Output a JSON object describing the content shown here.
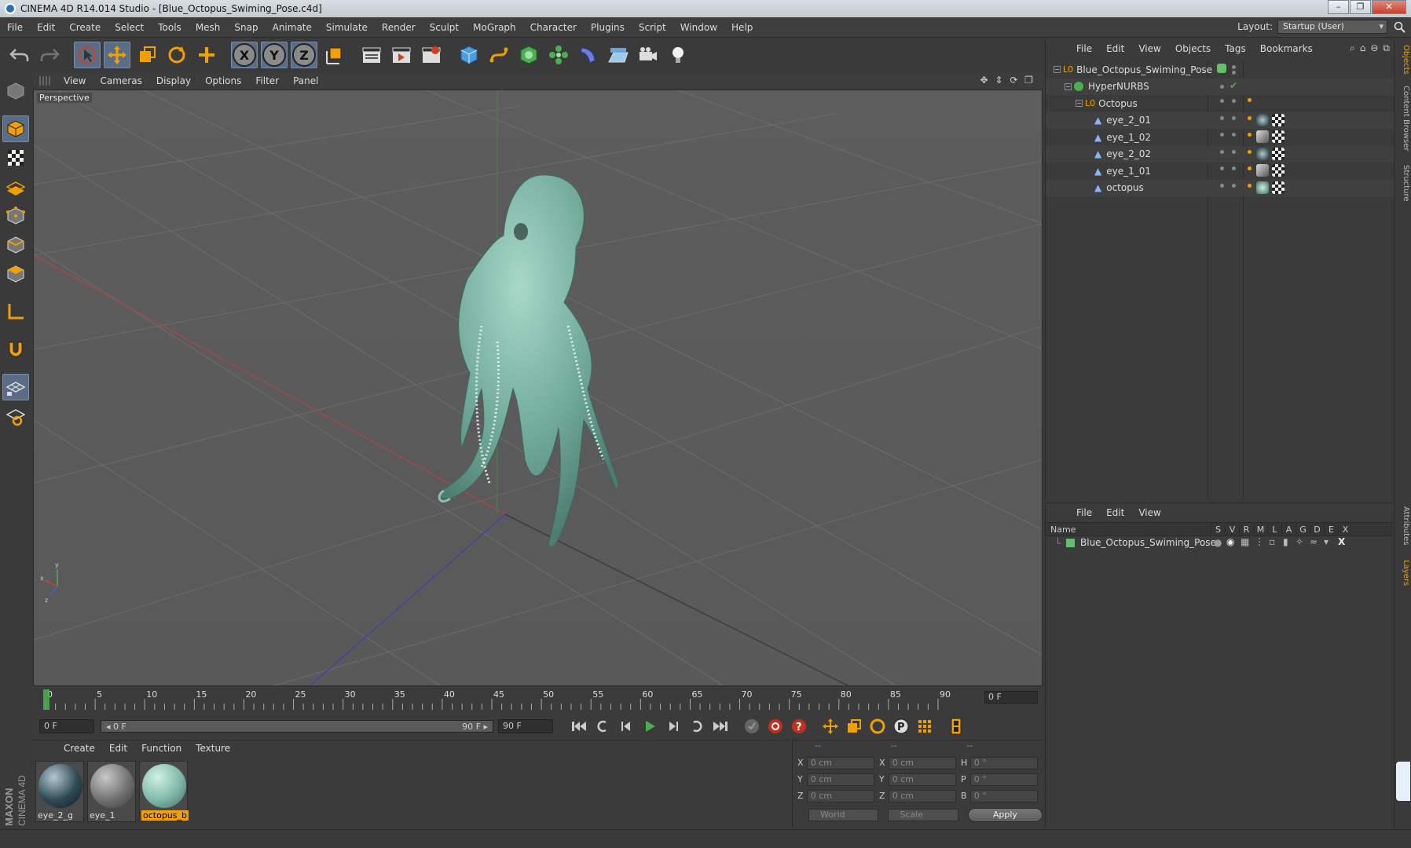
{
  "window": {
    "title": "CINEMA 4D R14.014 Studio - [Blue_Octopus_Swiming_Pose.c4d]",
    "minimize": "–",
    "restore": "❐",
    "close": "✕"
  },
  "menubar": [
    "File",
    "Edit",
    "Create",
    "Select",
    "Tools",
    "Mesh",
    "Snap",
    "Animate",
    "Simulate",
    "Render",
    "Sculpt",
    "MoGraph",
    "Character",
    "Plugins",
    "Script",
    "Window",
    "Help"
  ],
  "layout": {
    "label": "Layout:",
    "value": "Startup (User)"
  },
  "viewport": {
    "menu": [
      "View",
      "Cameras",
      "Display",
      "Options",
      "Filter",
      "Panel"
    ],
    "label": "Perspective"
  },
  "timeline": {
    "ticks": [
      "0",
      "5",
      "10",
      "15",
      "20",
      "25",
      "30",
      "35",
      "40",
      "45",
      "50",
      "55",
      "60",
      "65",
      "70",
      "75",
      "80",
      "85",
      "90"
    ],
    "current_frame": "0 F"
  },
  "transport": {
    "start_field": "0 F",
    "range_start": "◂ 0 F",
    "range_end": "90 F ▸",
    "end_field": "90 F"
  },
  "material_manager": {
    "menu": [
      "Create",
      "Edit",
      "Function",
      "Texture"
    ],
    "materials": [
      {
        "label": "eye_2_g",
        "selected": false
      },
      {
        "label": "eye_1",
        "selected": false
      },
      {
        "label": "octopus_b",
        "selected": true
      }
    ]
  },
  "coordinates": {
    "headers": [
      "--",
      "--",
      "--"
    ],
    "rows": [
      {
        "a1": "X",
        "v1": "0 cm",
        "a2": "X",
        "v2": "0 cm",
        "a3": "H",
        "v3": "0 °"
      },
      {
        "a1": "Y",
        "v1": "0 cm",
        "a2": "Y",
        "v2": "0 cm",
        "a3": "P",
        "v3": "0 °"
      },
      {
        "a1": "Z",
        "v1": "0 cm",
        "a2": "Z",
        "v2": "0 cm",
        "a3": "B",
        "v3": "0 °"
      }
    ],
    "space": "World",
    "mode": "Scale",
    "apply": "Apply"
  },
  "object_manager": {
    "menu": [
      "File",
      "Edit",
      "View",
      "Objects",
      "Tags",
      "Bookmarks"
    ],
    "objects": [
      {
        "name": "Blue_Octopus_Swiming_Pose"
      },
      {
        "name": "HyperNURBS"
      },
      {
        "name": "Octopus"
      },
      {
        "name": "eye_2_01"
      },
      {
        "name": "eye_1_02"
      },
      {
        "name": "eye_2_02"
      },
      {
        "name": "eye_1_01"
      },
      {
        "name": "octopus"
      }
    ]
  },
  "layer_manager": {
    "menu": [
      "File",
      "Edit",
      "View"
    ],
    "columns": [
      "Name",
      "S",
      "V",
      "R",
      "M",
      "L",
      "A",
      "G",
      "D",
      "E",
      "X"
    ],
    "layers": [
      {
        "name": "Blue_Octopus_Swiming_Pose",
        "color": "#5fc26a"
      }
    ]
  },
  "vertical_tabs": [
    "Objects",
    "Content Browser",
    "Structure",
    "Attributes",
    "Layers"
  ],
  "colors": {
    "accent": "#f0a000",
    "selection": "#5a6d86",
    "layer_green": "#5fc26a",
    "octopus": "#7fb8a8"
  }
}
